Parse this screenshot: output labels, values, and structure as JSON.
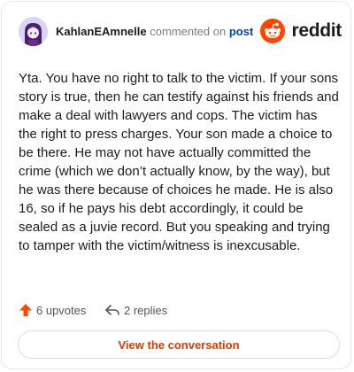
{
  "comment": {
    "username": "KahlanEAmnelle",
    "action_text": "commented on",
    "target_text": "post",
    "avatar_icon": "avatar-icon",
    "body": "Yta. You have no right to talk to the victim. If your sons story is true, then he can testify against his friends and make a deal with lawyers and cops. The victim has the right to press charges. Your son made a choice to be there. He may not have actually committed the crime (which we don’t actually know, by the way), but he was there because of choices he made. He is also 16, so if he pays his debt accordingly, it could be sealed as a juvie record. But you speaking and trying to tamper with the victim/witness is inexcusable."
  },
  "brand": {
    "name": "reddit",
    "icon": "reddit-logo-icon",
    "color": "#ff4500"
  },
  "actions": {
    "upvotes_label": "6 upvotes",
    "upvote_icon": "upvote-arrow-icon",
    "upvote_color": "#ff4500",
    "replies_label": "2 replies",
    "reply_icon": "reply-arrow-icon"
  },
  "footer": {
    "view_button_label": "View the conversation",
    "accent": "#d93a00"
  }
}
